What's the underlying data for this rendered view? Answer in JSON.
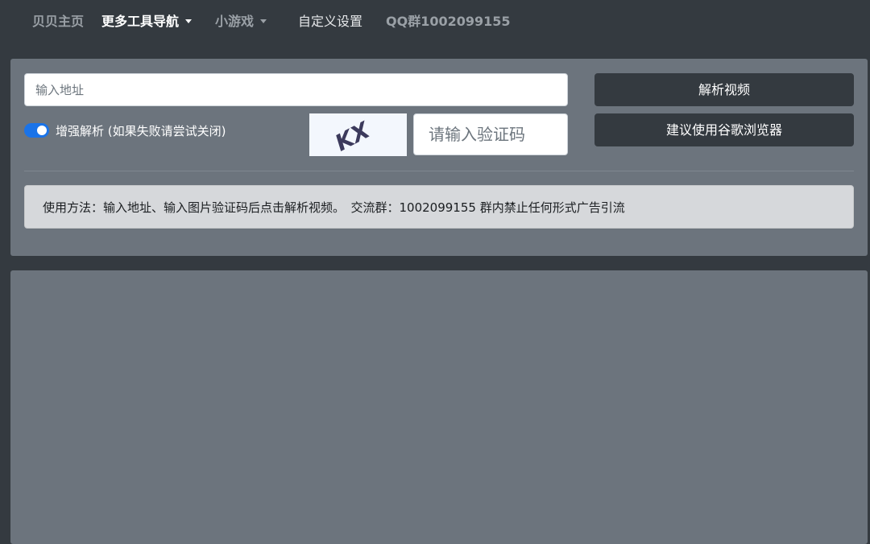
{
  "navbar": {
    "home": "贝贝主页",
    "tools": "更多工具导航",
    "games": "小游戏",
    "settings": "自定义设置",
    "qq_group": "QQ群1002099155"
  },
  "form": {
    "url_placeholder": "输入地址",
    "url_value": "",
    "enhance_label": "增强解析 (如果失败请尝试关闭)",
    "enhance_enabled": true,
    "captcha_placeholder": "请输入验证码",
    "captcha_value": "",
    "captcha_text": "KX",
    "parse_button": "解析视频",
    "chrome_button": "建议使用谷歌浏览器"
  },
  "usage": {
    "text": "使用方法：输入地址、输入图片验证码后点击解析视频。　交流群：1002099155 群内禁止任何形式广告引流"
  },
  "colors": {
    "navbar_bg": "#343a40",
    "panel_bg": "#6c747d",
    "switch_on": "#1a73e8",
    "button_bg": "#343a40",
    "alert_bg": "#d6d8db"
  },
  "icons": {
    "dropdown": "caret-down-icon"
  }
}
